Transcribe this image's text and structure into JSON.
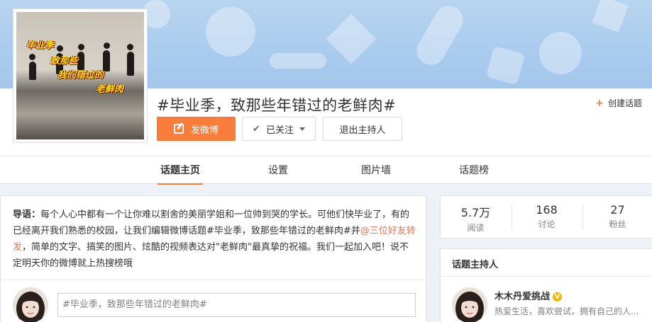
{
  "banner": {
    "bg_color": "#aecdf0"
  },
  "topic": {
    "title": "#毕业季，致那些年错过的老鲜肉#",
    "cover_text_1": "毕业季",
    "cover_text_2": "致那些",
    "cover_text_3": "我们错过的",
    "cover_text_4": "老鲜肉",
    "create_label": "创建话题"
  },
  "actions": {
    "post_label": "发微博",
    "follow_label": "已关注",
    "quit_label": "退出主持人",
    "accent_color": "#fa7d3c"
  },
  "tabs": [
    {
      "label": "话题主页",
      "active": true
    },
    {
      "label": "设置",
      "active": false
    },
    {
      "label": "图片墙",
      "active": false
    },
    {
      "label": "话题榜",
      "active": false
    }
  ],
  "intro": {
    "lead": "导语：",
    "text_1": "每个人心中都有一个让你难以割舍的美丽学姐和一位帅到哭的学长。可他们快毕业了，有的已经离开我们熟悉的校园，让我们编辑微博话题#毕业季，致那些年错过的老鲜肉#并",
    "mention": "@三位好友转发",
    "text_2": "，简单的文字、搞笑的图片、炫酷的视频表达对\"老鲜肉\"最真挚的祝福。我们一起加入吧！说不定明天你的微博就上热搜榜哦"
  },
  "composer": {
    "value": "#毕业季，致那些年错过的老鲜肉#"
  },
  "stats": [
    {
      "num": "5.7万",
      "label": "阅读"
    },
    {
      "num": "168",
      "label": "讨论"
    },
    {
      "num": "27",
      "label": "粉丝"
    }
  ],
  "host": {
    "title": "话题主持人",
    "name": "木木丹爱挑战",
    "verified_icon": "verified-v-icon",
    "desc": "热爱生活，喜欢尝试，拥有自己的人..."
  }
}
